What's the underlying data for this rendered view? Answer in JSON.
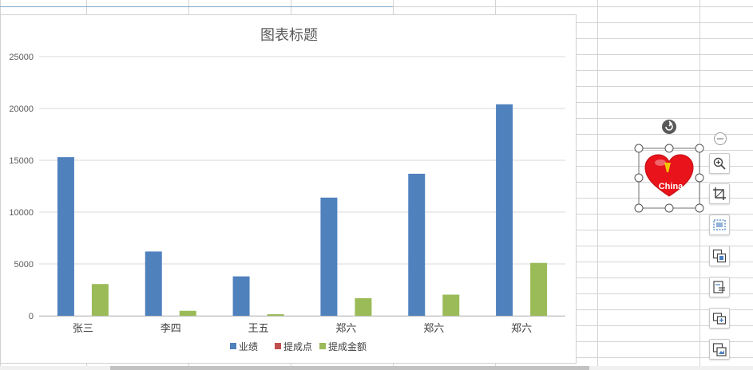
{
  "chart_data": {
    "type": "bar",
    "title": "图表标题",
    "categories": [
      "张三",
      "李四",
      "王五",
      "郑六",
      "郑六",
      "郑六"
    ],
    "series": [
      {
        "name": "业绩",
        "color": "#4f81bd",
        "values": [
          15300,
          6200,
          3800,
          11400,
          13700,
          20400
        ]
      },
      {
        "name": "提成点",
        "color": "#c0504d",
        "values": [
          0,
          0,
          0,
          0,
          0,
          0
        ]
      },
      {
        "name": "提成金额",
        "color": "#9bbb59",
        "values": [
          3060,
          480,
          150,
          1700,
          2040,
          5100
        ]
      }
    ],
    "ylim": [
      0,
      25000
    ],
    "yticks": [
      0,
      5000,
      10000,
      15000,
      20000,
      25000
    ],
    "legend": "bottom",
    "grid": true
  },
  "image_label": "China",
  "toolbar": {
    "buttons": [
      "collapse-icon",
      "zoom-icon",
      "crop-icon",
      "image-adjust-icon",
      "ocr-icon",
      "text-extract-icon",
      "copy-image-icon",
      "replace-image-icon"
    ]
  }
}
